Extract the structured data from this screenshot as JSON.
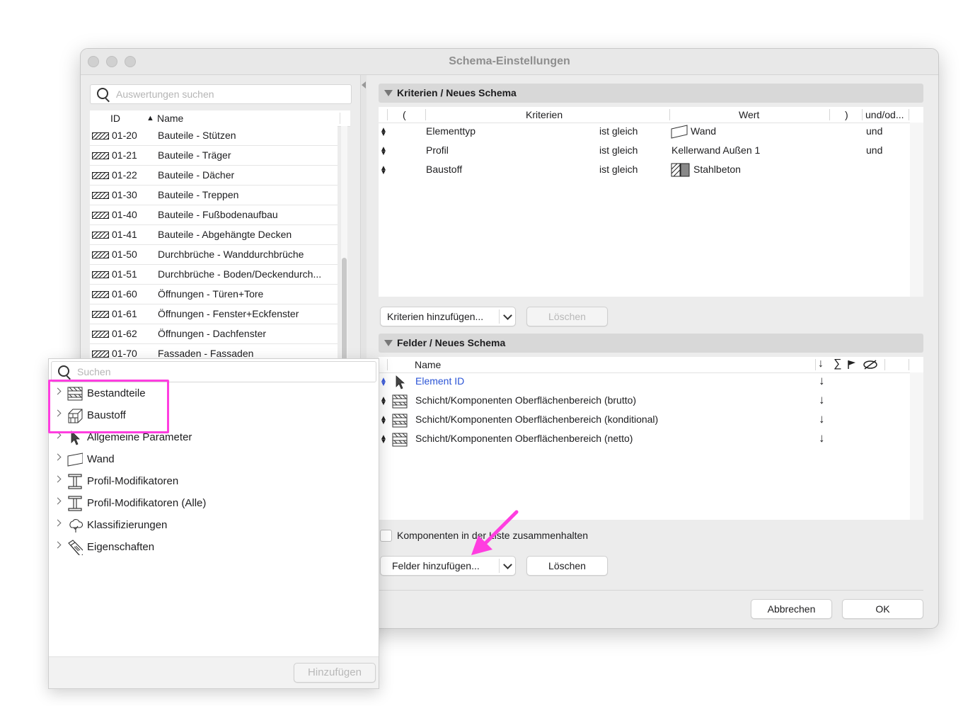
{
  "window": {
    "title": "Schema-Einstellungen"
  },
  "left": {
    "search_placeholder": "Auswertungen suchen",
    "col_id": "ID",
    "col_name": "Name",
    "rows": [
      {
        "id": "01-20",
        "name": "Bauteile - Stützen"
      },
      {
        "id": "01-21",
        "name": "Bauteile - Träger"
      },
      {
        "id": "01-22",
        "name": "Bauteile - Dächer"
      },
      {
        "id": "01-30",
        "name": "Bauteile - Treppen"
      },
      {
        "id": "01-40",
        "name": "Bauteile - Fußbodenaufbau"
      },
      {
        "id": "01-41",
        "name": "Bauteile - Abgehängte Decken"
      },
      {
        "id": "01-50",
        "name": "Durchbrüche - Wanddurchbrüche"
      },
      {
        "id": "01-51",
        "name": "Durchbrüche - Boden/Deckendurch..."
      },
      {
        "id": "01-60",
        "name": "Öffnungen - Türen+Tore"
      },
      {
        "id": "01-61",
        "name": "Öffnungen - Fenster+Eckfenster"
      },
      {
        "id": "01-62",
        "name": "Öffnungen - Dachfenster"
      },
      {
        "id": "01-70",
        "name": "Fassaden - Fassaden"
      }
    ]
  },
  "criteria": {
    "section_title": "Kriterien /  Neues Schema",
    "headers": {
      "open": "(",
      "criteria": "Kriterien",
      "value": "Wert",
      "close": ")",
      "andor": "und/od..."
    },
    "rows": [
      {
        "field": "Elementtyp",
        "op": "ist gleich",
        "value": "Wand",
        "andor": "und"
      },
      {
        "field": "Profil",
        "op": "ist gleich",
        "value": "Kellerwand Außen 1",
        "andor": "und"
      },
      {
        "field": "Baustoff",
        "op": "ist gleich",
        "value": "Stahlbeton",
        "andor": ""
      }
    ],
    "add_button": "Kriterien hinzufügen...",
    "delete_button": "Löschen"
  },
  "fields": {
    "section_title": "Felder /  Neues Schema",
    "header_name": "Name",
    "header_sort": "↓",
    "header_sum": "∑",
    "rows": [
      {
        "name": "Element ID",
        "sort": "↓"
      },
      {
        "name": "Schicht/Komponenten Oberflächenbereich (brutto)",
        "sort": "↓"
      },
      {
        "name": "Schicht/Komponenten Oberflächenbereich (konditional)",
        "sort": "↓"
      },
      {
        "name": "Schicht/Komponenten Oberflächenbereich (netto)",
        "sort": "↓"
      }
    ],
    "keep_together_label": "Komponenten in der Liste zusammenhalten",
    "keep_together_checked": false,
    "add_button": "Felder hinzufügen...",
    "delete_button": "Löschen"
  },
  "footer": {
    "cancel": "Abbrechen",
    "ok": "OK"
  },
  "popup": {
    "search_placeholder": "Suchen",
    "items": [
      {
        "label": "Bestandteile",
        "icon": "layers-icon"
      },
      {
        "label": "Baustoff",
        "icon": "building-material-icon"
      },
      {
        "label": "Allgemeine Parameter",
        "icon": "arrow-cursor-icon"
      },
      {
        "label": "Wand",
        "icon": "wall-icon"
      },
      {
        "label": "Profil-Modifikatoren",
        "icon": "i-beam-icon"
      },
      {
        "label": "Profil-Modifikatoren (Alle)",
        "icon": "i-beam-icon"
      },
      {
        "label": "Klassifizierungen",
        "icon": "tree-icon"
      },
      {
        "label": "Eigenschaften",
        "icon": "tags-icon"
      }
    ],
    "add_button": "Hinzufügen"
  },
  "annotations": {
    "highlight_color": "#ff3ee0"
  }
}
